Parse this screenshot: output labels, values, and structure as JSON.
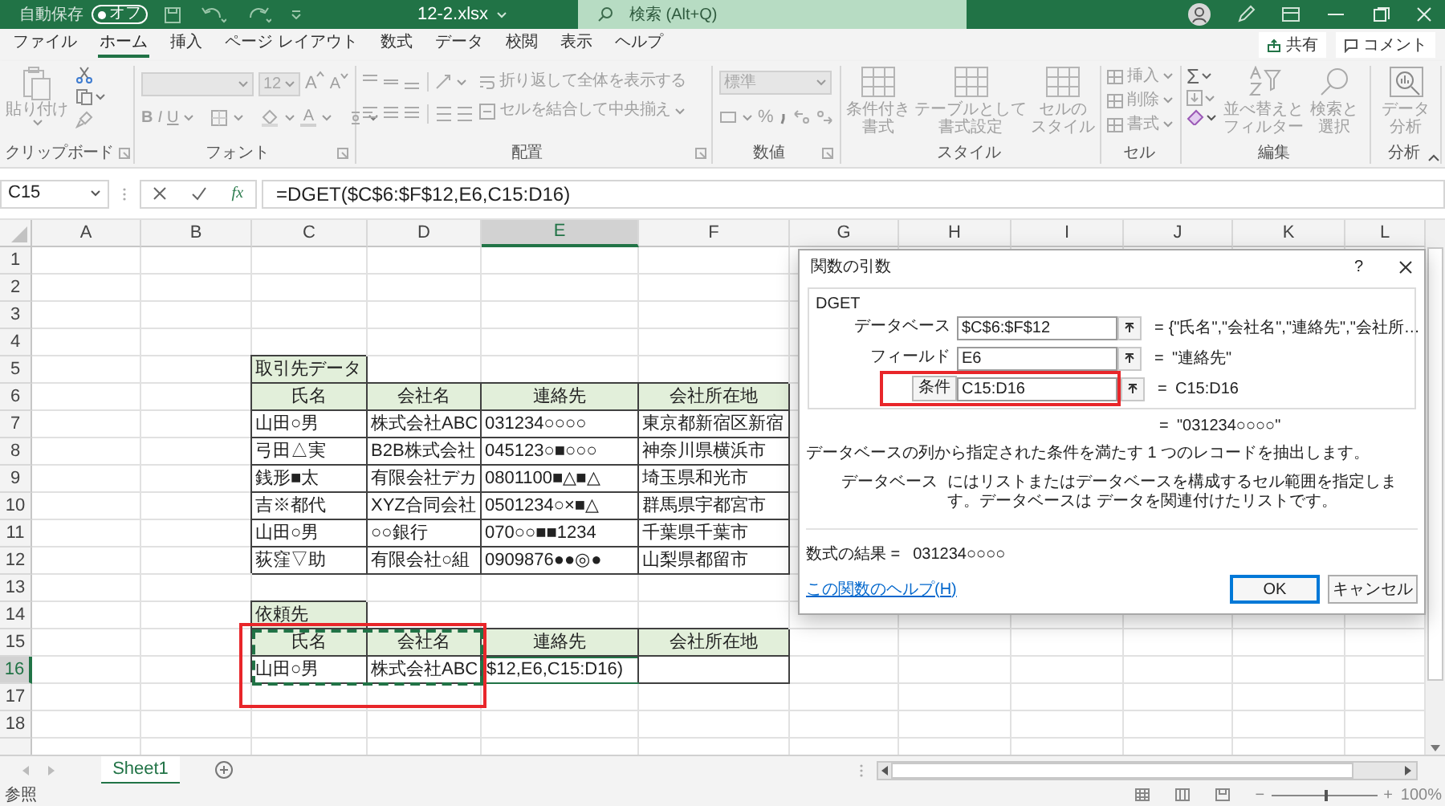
{
  "title_bar": {
    "autosave_label": "自動保存",
    "autosave": {
      "label": "オフ",
      "on": false
    },
    "file_name": "12-2.xlsx",
    "search_placeholder": "検索 (Alt+Q)"
  },
  "menu_tabs": [
    {
      "label": "ファイル",
      "selected": false
    },
    {
      "label": "ホーム",
      "selected": true
    },
    {
      "label": "挿入",
      "selected": false
    },
    {
      "label": "ページ レイアウト",
      "selected": false
    },
    {
      "label": "数式",
      "selected": false
    },
    {
      "label": "データ",
      "selected": false
    },
    {
      "label": "校閲",
      "selected": false
    },
    {
      "label": "表示",
      "selected": false
    },
    {
      "label": "ヘルプ",
      "selected": false
    }
  ],
  "share_button": "共有",
  "comment_button": "コメント",
  "ribbon": {
    "clipboard": {
      "label": "クリップボード",
      "paste": "貼り付け"
    },
    "font": {
      "label": "フォント",
      "font_size": "12",
      "grow": "A",
      "shrink": "A",
      "bold": "B",
      "italic": "I",
      "underline": "U",
      "font_color": "A"
    },
    "alignment": {
      "label": "配置",
      "wrap_text": "折り返して全体を表示する",
      "merge_center": "セルを結合して中央揃え"
    },
    "number": {
      "label": "数値",
      "format": "標準",
      "percent": "%"
    },
    "styles": {
      "label": "スタイル",
      "buttons": [
        [
          "条件付き",
          "書式"
        ],
        [
          "テーブルとして",
          "書式設定"
        ],
        [
          "セルの",
          "スタイル"
        ]
      ]
    },
    "cells": {
      "label": "セル",
      "buttons": [
        "挿入",
        "削除",
        "書式"
      ]
    },
    "editing": {
      "label": "編集",
      "autosum": "Σ",
      "buttons": [
        [
          "並べ替えと",
          "フィルター"
        ],
        [
          "検索と",
          "選択"
        ]
      ]
    },
    "analysis": {
      "label": "分析",
      "buttons": [
        [
          "データ",
          "分析"
        ]
      ]
    }
  },
  "formula_bar": {
    "name_box": "C15",
    "function_button": "fx",
    "formula": "=DGET($C$6:$F$12,E6,C15:D16)"
  },
  "sheet": {
    "marquee": true,
    "columns": [
      {
        "label": "A",
        "selected": false
      },
      {
        "label": "B",
        "selected": false
      },
      {
        "label": "C",
        "selected": false
      },
      {
        "label": "D",
        "selected": false
      },
      {
        "label": "E",
        "selected": true
      },
      {
        "label": "F",
        "selected": false
      },
      {
        "label": "G",
        "selected": false
      },
      {
        "label": "H",
        "selected": false
      },
      {
        "label": "I",
        "selected": false
      },
      {
        "label": "J",
        "selected": false
      },
      {
        "label": "K",
        "selected": false
      },
      {
        "label": "L",
        "selected": false
      }
    ],
    "rows": [
      {
        "label": "1",
        "selected": false
      },
      {
        "label": "2",
        "selected": false
      },
      {
        "label": "3",
        "selected": false
      },
      {
        "label": "4",
        "selected": false
      },
      {
        "label": "5",
        "selected": false
      },
      {
        "label": "6",
        "selected": false
      },
      {
        "label": "7",
        "selected": false
      },
      {
        "label": "8",
        "selected": false
      },
      {
        "label": "9",
        "selected": false
      },
      {
        "label": "10",
        "selected": false
      },
      {
        "label": "11",
        "selected": false
      },
      {
        "label": "12",
        "selected": false
      },
      {
        "label": "13",
        "selected": false
      },
      {
        "label": "14",
        "selected": false
      },
      {
        "label": "15",
        "selected": false
      },
      {
        "label": "16",
        "selected": true
      },
      {
        "label": "17",
        "selected": false
      },
      {
        "label": "18",
        "selected": false
      }
    ],
    "tables": [
      {
        "title": "取引先データ",
        "headers": [
          "氏名",
          "会社名",
          "連絡先",
          "会社所在地"
        ],
        "rows": [
          [
            "山田○男",
            "株式会社ABC",
            "031234○○○○",
            "東京都新宿区新宿"
          ],
          [
            "弓田△実",
            "B2B株式会社",
            "045123○■○○○",
            "神奈川県横浜市"
          ],
          [
            "銭形■太",
            "有限会社デカ",
            "0801100■△■△",
            "埼玉県和光市"
          ],
          [
            "吉※都代",
            "XYZ合同会社",
            "0501234○×■△",
            "群馬県宇都宮市"
          ],
          [
            "山田○男",
            "○○銀行",
            "070○○■■1234",
            "千葉県千葉市"
          ],
          [
            "荻窪▽助",
            "有限会社○組",
            "0909876●●◎●",
            "山梨県都留市"
          ]
        ]
      },
      {
        "title": "依頼先",
        "headers": [
          "氏名",
          "会社名",
          "連絡先",
          "会社所在地"
        ],
        "rows": [
          [
            "山田○男",
            "株式会社ABC"
          ]
        ]
      }
    ],
    "editing_cell": "$12,E6,C15:D16)"
  },
  "sheet_tabs": [
    {
      "label": "Sheet1",
      "selected": true
    }
  ],
  "status_bar": {
    "mode": "参照",
    "zoom_out": "−",
    "zoom_slider": {
      "level": 0.5
    },
    "zoom_in": "+",
    "zoom": "100%"
  },
  "dialog": {
    "title": "関数の引数",
    "help": "?",
    "function": "DGET",
    "arguments": [
      {
        "label": "データベース",
        "value": "$C$6:$F$12",
        "equals": "=",
        "result": "{\"氏名\",\"会社名\",\"連絡先\",\"会社所…",
        "selected": false
      },
      {
        "label": "フィールド",
        "value": "E6",
        "equals": "=",
        "result": "\"連絡先\"",
        "selected": false
      },
      {
        "label": "条件",
        "value": "C15:D16",
        "equals": "=",
        "result": "C15:D16",
        "selected": true
      }
    ],
    "value": {
      "equals": "=",
      "text": "\"031234○○○○\""
    },
    "description": "データベースの列から指定された条件を満たす 1 つのレコードを抽出します。",
    "argument_help": {
      "name": "データベース",
      "text": "にはリストまたはデータベースを構成するセル範囲を指定します。データベースは データを関連付けたリストです。"
    },
    "formula_result": {
      "label": "数式の結果 =",
      "value": "031234○○○○"
    },
    "help_link": "この関数のヘルプ(H)",
    "buttons": [
      {
        "label": "OK",
        "default": true
      },
      {
        "label": "キャンセル",
        "default": false
      }
    ]
  }
}
